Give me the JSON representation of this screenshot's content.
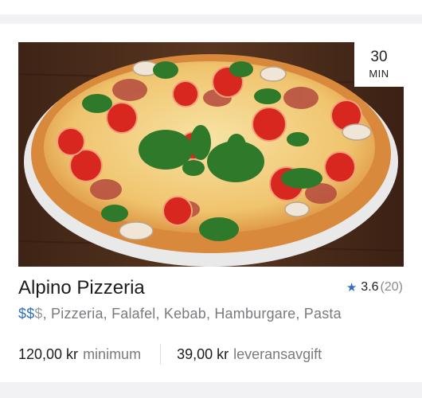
{
  "delivery_time": {
    "value": "30",
    "unit": "MIN"
  },
  "restaurant": {
    "name": "Alpino Pizzeria",
    "rating": "3.6",
    "rating_count": "(20)",
    "price_level_active": "$$",
    "price_level_inactive": "$",
    "categories": ", Pizzeria, Falafel, Kebab, Hamburgare, Pasta"
  },
  "fees": {
    "minimum_amount": "120,00 kr",
    "minimum_label": "minimum",
    "delivery_amount": "39,00 kr",
    "delivery_label": "leveransavgift"
  },
  "colors": {
    "accent": "#2f6fbd",
    "background": "#f2f2f4"
  },
  "icons": {
    "rating": "star-icon"
  }
}
